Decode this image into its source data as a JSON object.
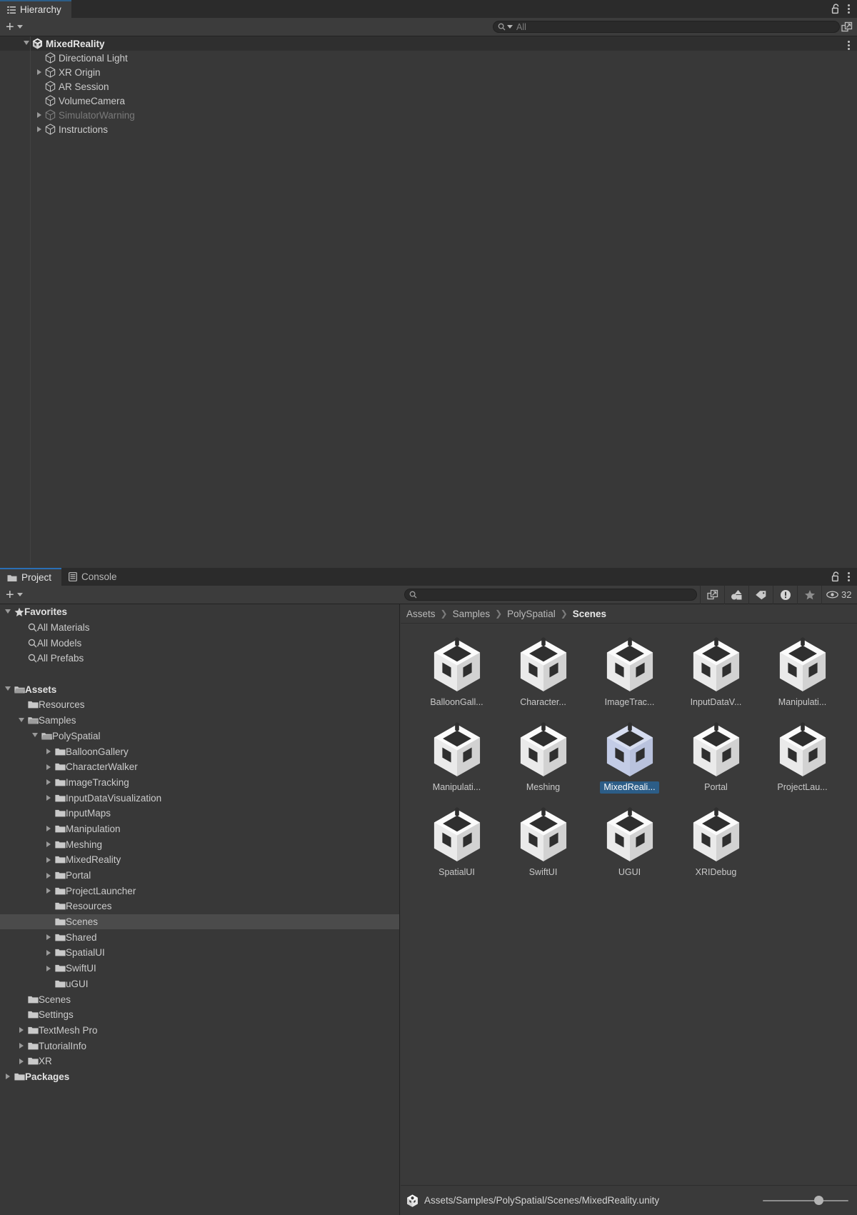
{
  "hierarchy": {
    "tab_label": "Hierarchy",
    "tab_icon": "hierarchy-icon",
    "add_label": "+",
    "search": {
      "value": "",
      "placeholder": "All"
    },
    "lock_icon": "lock-open-icon",
    "menu_icon": "kebab-menu-icon",
    "rows": [
      {
        "label": "MixedReality",
        "depth": 0,
        "arrow": "open",
        "type": "scene",
        "dim": false
      },
      {
        "label": "Directional Light",
        "depth": 1,
        "arrow": "none",
        "type": "gameobject",
        "dim": false
      },
      {
        "label": "XR Origin",
        "depth": 1,
        "arrow": "closed",
        "type": "gameobject",
        "dim": false
      },
      {
        "label": "AR Session",
        "depth": 1,
        "arrow": "none",
        "type": "gameobject",
        "dim": false
      },
      {
        "label": "VolumeCamera",
        "depth": 1,
        "arrow": "none",
        "type": "gameobject",
        "dim": false
      },
      {
        "label": "SimulatorWarning",
        "depth": 1,
        "arrow": "closed",
        "type": "gameobject",
        "dim": true
      },
      {
        "label": "Instructions",
        "depth": 1,
        "arrow": "closed",
        "type": "gameobject",
        "dim": false
      }
    ]
  },
  "project": {
    "tabs": [
      {
        "label": "Project",
        "icon": "folder-icon",
        "active": true
      },
      {
        "label": "Console",
        "icon": "console-icon",
        "active": false
      }
    ],
    "lock_icon": "lock-open-icon",
    "menu_icon": "kebab-menu-icon",
    "add_label": "+",
    "search": {
      "value": "",
      "placeholder": ""
    },
    "toolbar_icons": [
      {
        "name": "open-in-new-icon"
      },
      {
        "name": "asset-type-filter-icon"
      },
      {
        "name": "label-tag-icon"
      },
      {
        "name": "warning-icon"
      },
      {
        "name": "favorite-star-icon"
      }
    ],
    "visible_count_icon": "eye-icon",
    "visible_count": "32",
    "tree": [
      {
        "label": "Favorites",
        "depth": 0,
        "arrow": "open",
        "icon": "star-icon",
        "bold": true,
        "selected": false
      },
      {
        "label": "All Materials",
        "depth": 1,
        "arrow": "none",
        "icon": "search-icon",
        "bold": false,
        "selected": false
      },
      {
        "label": "All Models",
        "depth": 1,
        "arrow": "none",
        "icon": "search-icon",
        "bold": false,
        "selected": false
      },
      {
        "label": "All Prefabs",
        "depth": 1,
        "arrow": "none",
        "icon": "search-icon",
        "bold": false,
        "selected": false
      },
      {
        "label": "",
        "depth": 0,
        "arrow": "none",
        "icon": "none",
        "bold": false,
        "selected": false
      },
      {
        "label": "Assets",
        "depth": 0,
        "arrow": "open",
        "icon": "folder-open-icon",
        "bold": true,
        "selected": false
      },
      {
        "label": "Resources",
        "depth": 1,
        "arrow": "none",
        "icon": "folder-icon",
        "bold": false,
        "selected": false
      },
      {
        "label": "Samples",
        "depth": 1,
        "arrow": "open",
        "icon": "folder-open-icon",
        "bold": false,
        "selected": false
      },
      {
        "label": "PolySpatial",
        "depth": 2,
        "arrow": "open",
        "icon": "folder-open-icon",
        "bold": false,
        "selected": false
      },
      {
        "label": "BalloonGallery",
        "depth": 3,
        "arrow": "closed",
        "icon": "folder-icon",
        "bold": false,
        "selected": false
      },
      {
        "label": "CharacterWalker",
        "depth": 3,
        "arrow": "closed",
        "icon": "folder-icon",
        "bold": false,
        "selected": false
      },
      {
        "label": "ImageTracking",
        "depth": 3,
        "arrow": "closed",
        "icon": "folder-icon",
        "bold": false,
        "selected": false
      },
      {
        "label": "InputDataVisualization",
        "depth": 3,
        "arrow": "closed",
        "icon": "folder-icon",
        "bold": false,
        "selected": false
      },
      {
        "label": "InputMaps",
        "depth": 3,
        "arrow": "none",
        "icon": "folder-icon",
        "bold": false,
        "selected": false
      },
      {
        "label": "Manipulation",
        "depth": 3,
        "arrow": "closed",
        "icon": "folder-icon",
        "bold": false,
        "selected": false
      },
      {
        "label": "Meshing",
        "depth": 3,
        "arrow": "closed",
        "icon": "folder-icon",
        "bold": false,
        "selected": false
      },
      {
        "label": "MixedReality",
        "depth": 3,
        "arrow": "closed",
        "icon": "folder-icon",
        "bold": false,
        "selected": false
      },
      {
        "label": "Portal",
        "depth": 3,
        "arrow": "closed",
        "icon": "folder-icon",
        "bold": false,
        "selected": false
      },
      {
        "label": "ProjectLauncher",
        "depth": 3,
        "arrow": "closed",
        "icon": "folder-icon",
        "bold": false,
        "selected": false
      },
      {
        "label": "Resources",
        "depth": 3,
        "arrow": "none",
        "icon": "folder-icon",
        "bold": false,
        "selected": false
      },
      {
        "label": "Scenes",
        "depth": 3,
        "arrow": "none",
        "icon": "folder-icon",
        "bold": false,
        "selected": true
      },
      {
        "label": "Shared",
        "depth": 3,
        "arrow": "closed",
        "icon": "folder-icon",
        "bold": false,
        "selected": false
      },
      {
        "label": "SpatialUI",
        "depth": 3,
        "arrow": "closed",
        "icon": "folder-icon",
        "bold": false,
        "selected": false
      },
      {
        "label": "SwiftUI",
        "depth": 3,
        "arrow": "closed",
        "icon": "folder-icon",
        "bold": false,
        "selected": false
      },
      {
        "label": "uGUI",
        "depth": 3,
        "arrow": "none",
        "icon": "folder-icon",
        "bold": false,
        "selected": false
      },
      {
        "label": "Scenes",
        "depth": 1,
        "arrow": "none",
        "icon": "folder-icon",
        "bold": false,
        "selected": false
      },
      {
        "label": "Settings",
        "depth": 1,
        "arrow": "none",
        "icon": "folder-icon",
        "bold": false,
        "selected": false
      },
      {
        "label": "TextMesh Pro",
        "depth": 1,
        "arrow": "closed",
        "icon": "folder-icon",
        "bold": false,
        "selected": false
      },
      {
        "label": "TutorialInfo",
        "depth": 1,
        "arrow": "closed",
        "icon": "folder-icon",
        "bold": false,
        "selected": false
      },
      {
        "label": "XR",
        "depth": 1,
        "arrow": "closed",
        "icon": "folder-icon",
        "bold": false,
        "selected": false
      },
      {
        "label": "Packages",
        "depth": 0,
        "arrow": "closed",
        "icon": "folder-icon",
        "bold": true,
        "selected": false
      }
    ],
    "breadcrumb": [
      {
        "label": "Assets",
        "last": false
      },
      {
        "label": "Samples",
        "last": false
      },
      {
        "label": "PolySpatial",
        "last": false
      },
      {
        "label": "Scenes",
        "last": true
      }
    ],
    "assets": [
      {
        "label": "BalloonGall...",
        "icon": "unity-scene-icon",
        "selected": false
      },
      {
        "label": "Character...",
        "icon": "unity-scene-icon",
        "selected": false
      },
      {
        "label": "ImageTrac...",
        "icon": "unity-scene-icon",
        "selected": false
      },
      {
        "label": "InputDataV...",
        "icon": "unity-scene-icon",
        "selected": false
      },
      {
        "label": "Manipulati...",
        "icon": "unity-scene-icon",
        "selected": false
      },
      {
        "label": "Manipulati...",
        "icon": "unity-scene-icon",
        "selected": false
      },
      {
        "label": "Meshing",
        "icon": "unity-scene-icon",
        "selected": false
      },
      {
        "label": "MixedReali...",
        "icon": "unity-scene-icon",
        "selected": true
      },
      {
        "label": "Portal",
        "icon": "unity-scene-icon",
        "selected": false
      },
      {
        "label": "ProjectLau...",
        "icon": "unity-scene-icon",
        "selected": false
      },
      {
        "label": "SpatialUI",
        "icon": "unity-scene-icon",
        "selected": false
      },
      {
        "label": "SwiftUI",
        "icon": "unity-scene-icon",
        "selected": false
      },
      {
        "label": "UGUI",
        "icon": "unity-scene-icon",
        "selected": false
      },
      {
        "label": "XRIDebug",
        "icon": "unity-scene-icon",
        "selected": false
      }
    ],
    "statusbar": {
      "icon": "unity-scene-icon",
      "path": "Assets/Samples/PolySpatial/Scenes/MixedReality.unity",
      "zoom_slider_value": "60"
    }
  },
  "colors": {
    "accent_selection": "#2c5d87",
    "panel_bg": "#383838",
    "tabbar_bg": "#2b2b2b",
    "toolbar_bg": "#3c3c3c",
    "row_selected": "#4b4b4b"
  }
}
